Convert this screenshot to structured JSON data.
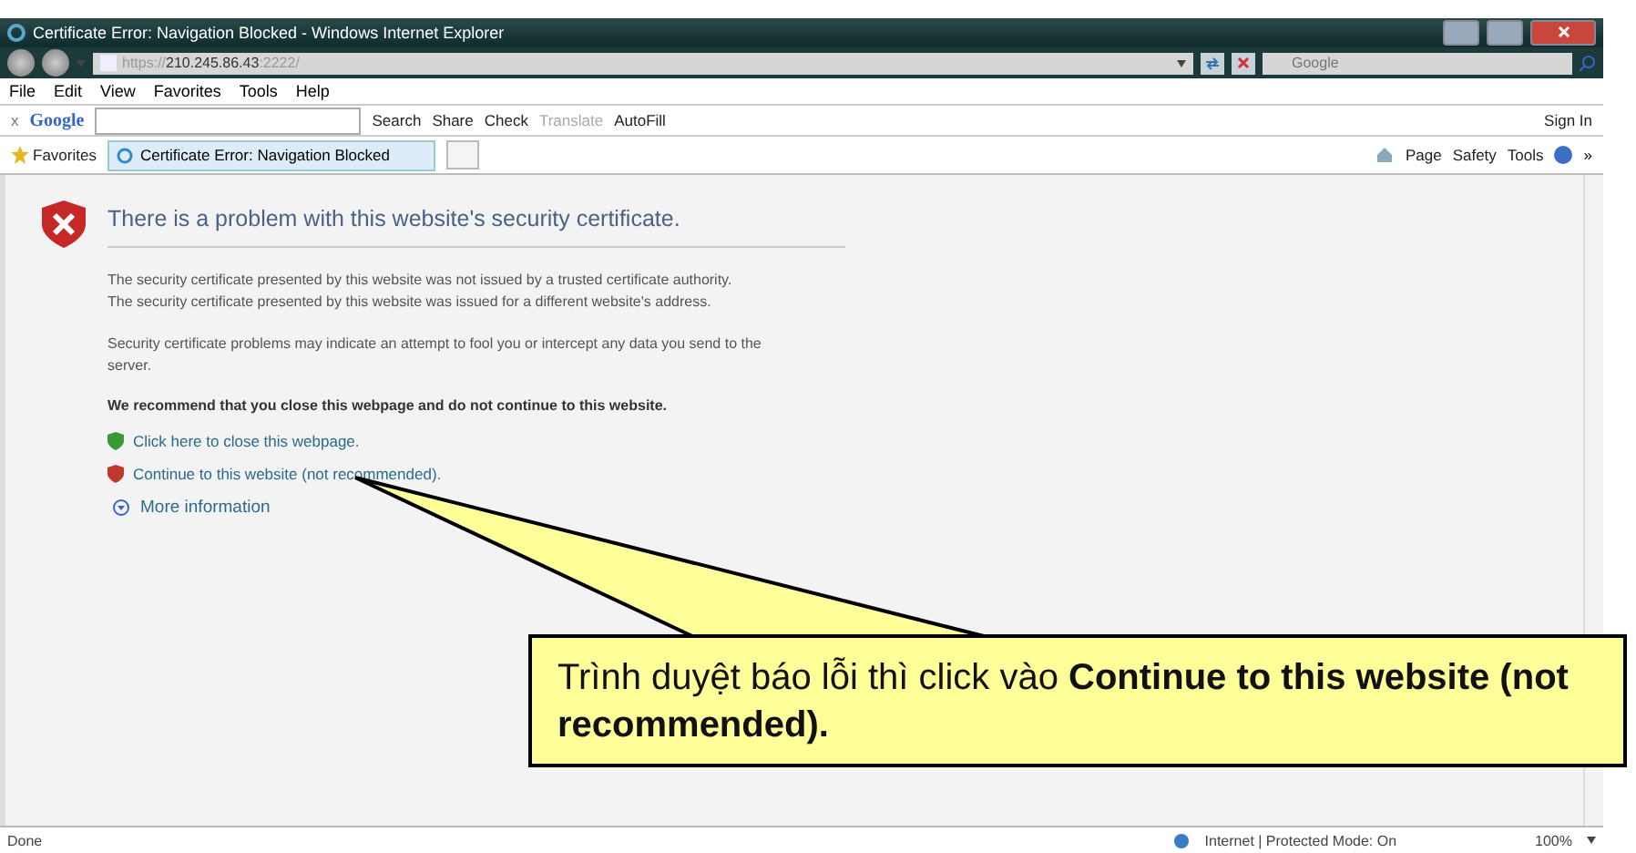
{
  "window": {
    "title": "Certificate Error: Navigation Blocked - Windows Internet Explorer"
  },
  "address_bar": {
    "url": "https://**210.245.86.43**:2222/"
  },
  "search_box": {
    "placeholder": "Google"
  },
  "menu": [
    "File",
    "Edit",
    "View",
    "Favorites",
    "Tools",
    "Help"
  ],
  "google_toolbar": {
    "close": "x",
    "logo": "Google",
    "buttons": [
      {
        "label": "Search",
        "disabled": false
      },
      {
        "label": "Share",
        "disabled": false
      },
      {
        "label": "Check",
        "disabled": false
      },
      {
        "label": "Translate",
        "disabled": true
      },
      {
        "label": "AutoFill",
        "disabled": false
      }
    ],
    "sign_in": "Sign In"
  },
  "favorites_bar": {
    "favorites": "Favorites",
    "tab": "Certificate Error: Navigation Blocked",
    "commands": [
      "Page",
      "Safety",
      "Tools"
    ],
    "overflow": "»"
  },
  "page": {
    "heading": "There is a problem with this website's security certificate.",
    "paragraphs": [
      "The security certificate presented by this website was not issued by a trusted certificate authority.\nThe security certificate presented by this website was issued for a different website's address.",
      "Security certificate problems may indicate an attempt to fool you or intercept any data you send to the server."
    ],
    "recommendation": "We recommend that you close this webpage and do not continue to this website.",
    "links": [
      {
        "kind": "safe",
        "label": "Click here to close this webpage."
      },
      {
        "kind": "unsafe",
        "label": "Continue to this website (not recommended)."
      }
    ],
    "more_info": "More information"
  },
  "callout": {
    "text": "Trình duyệt báo lỗi thì click vào **Continue to this website (not recommended).**"
  },
  "status_bar": {
    "text": "Done",
    "zone": "Internet | Protected Mode: On",
    "zoom": "100%"
  }
}
